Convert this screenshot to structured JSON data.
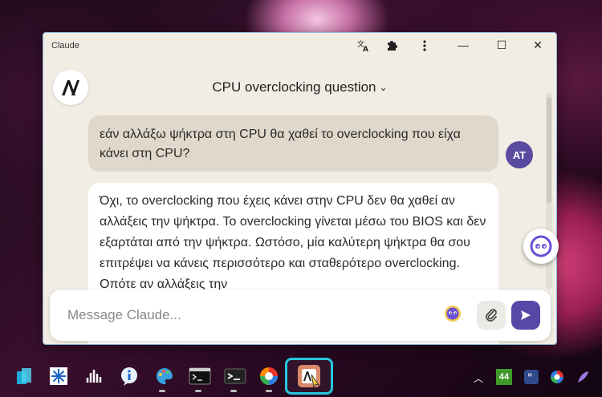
{
  "window": {
    "app_title": "Claude",
    "conversation_title": "CPU overclocking question",
    "minimize_symbol": "—",
    "maximize_symbol": "☐",
    "close_symbol": "✕"
  },
  "user": {
    "avatar_initials": "AT"
  },
  "messages": {
    "user_message": "εάν αλλάξω ψήκτρα στη CPU θα χαθεί το overclocking που είχα κάνει στη CPU?",
    "assistant_message": "Όχι, το overclocking που έχεις κάνει στην CPU δεν θα χαθεί αν αλλάξεις την ψήκτρα. Το overclocking γίνεται μέσω του BIOS και δεν εξαρτάται από την ψήκτρα. Ωστόσο, μία καλύτερη ψήκτρα θα σου επιτρέψει να κάνεις περισσότερο και σταθερότερο overclocking. Οπότε αν αλλάξεις την"
  },
  "composer": {
    "placeholder": "Message Claude..."
  },
  "tray": {
    "badge_number": "44"
  },
  "icons": {
    "titlebar": [
      "translate-icon",
      "puzzle-extension-icon",
      "more-vertical-icon"
    ],
    "taskbar": [
      "stacked-app-icon",
      "network-snowflake-icon",
      "audio-bars-icon",
      "info-icon",
      "paint-palette-icon",
      "terminal-window-icon",
      "command-prompt-icon",
      "browser-swirl-icon",
      "claude-app-icon"
    ],
    "tray": [
      "chevron-up-icon",
      "quote-icon",
      "color-swirl-icon",
      "feather-icon"
    ]
  },
  "colors": {
    "accent": "#5748a8",
    "active_taskbar_border": "#26c6e0",
    "window_bg": "#f1ede4",
    "user_bubble": "#e0d8cb"
  }
}
